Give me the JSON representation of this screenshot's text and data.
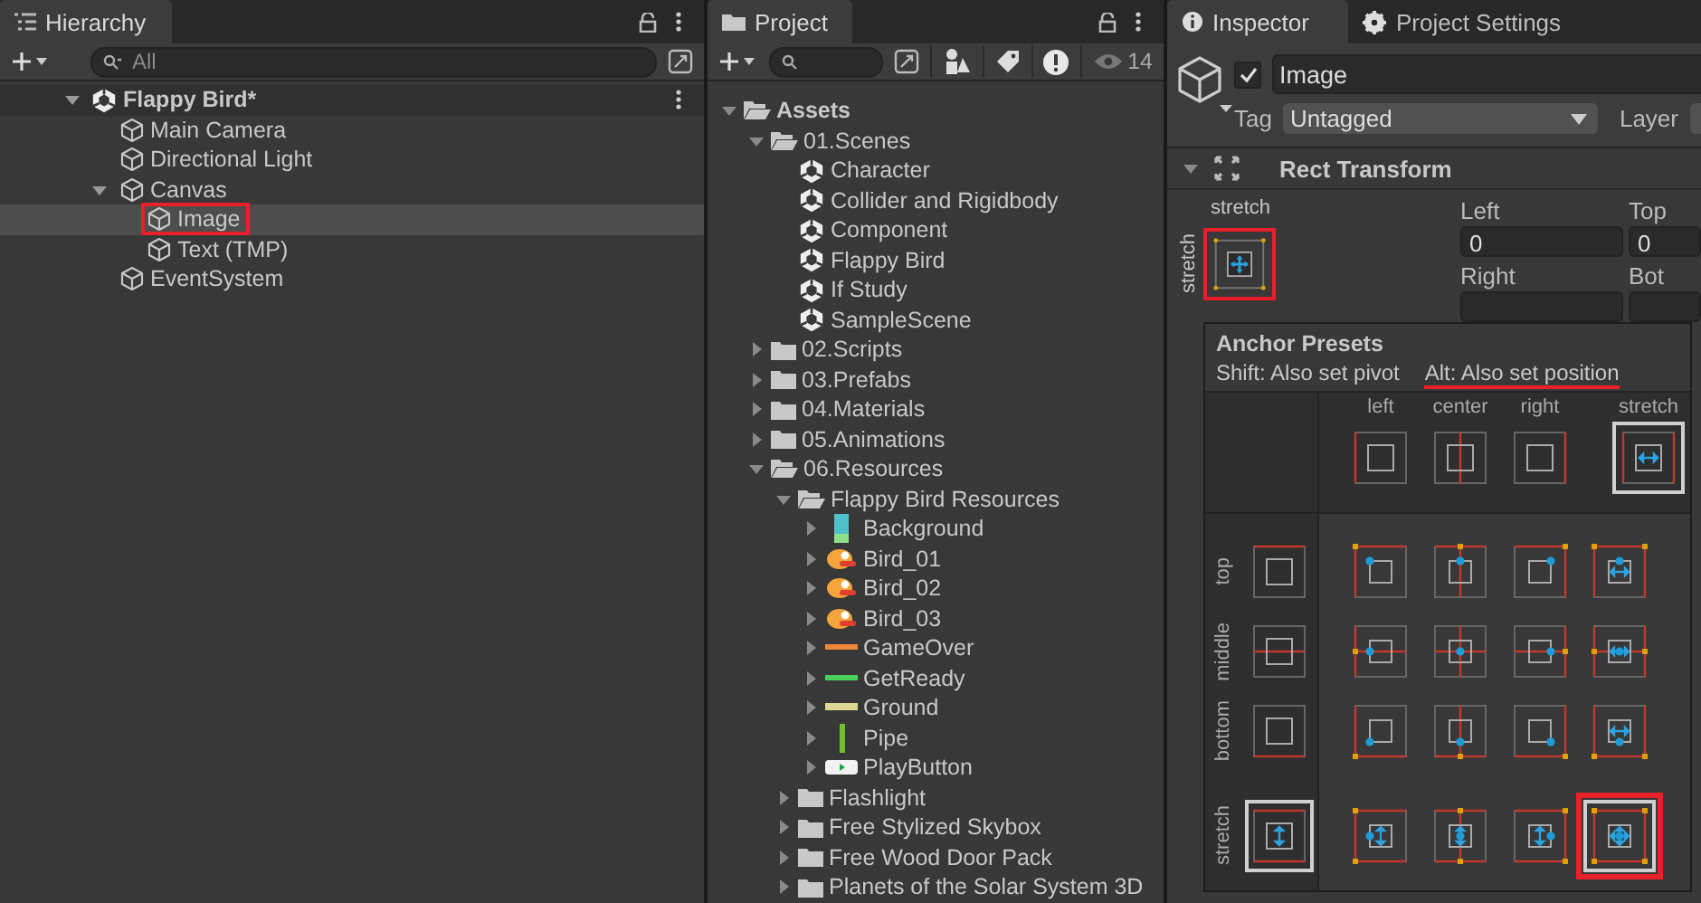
{
  "hierarchy": {
    "tab": "Hierarchy",
    "search": {
      "placeholder": "All"
    },
    "tree": [
      {
        "label": "Flappy Bird*",
        "kind": "scene",
        "expanded": true,
        "selected": false,
        "highlighted": false,
        "children": [
          {
            "label": "Main Camera",
            "kind": "object",
            "selected": false,
            "highlighted": false
          },
          {
            "label": "Directional Light",
            "kind": "object",
            "selected": false,
            "highlighted": false
          },
          {
            "label": "Canvas",
            "kind": "object",
            "expanded": true,
            "selected": false,
            "highlighted": false,
            "children": [
              {
                "label": "Image",
                "kind": "object",
                "selected": true,
                "highlighted": true
              },
              {
                "label": "Text (TMP)",
                "kind": "object",
                "selected": false,
                "highlighted": false
              }
            ]
          },
          {
            "label": "EventSystem",
            "kind": "object",
            "selected": false,
            "highlighted": false
          }
        ]
      }
    ]
  },
  "project": {
    "tab": "Project",
    "hidden_count": "14",
    "tree": [
      {
        "label": "Assets",
        "kind": "folder",
        "expanded": true,
        "children": [
          {
            "label": "01.Scenes",
            "kind": "folder",
            "expanded": true,
            "children": [
              {
                "label": "Character",
                "kind": "scene"
              },
              {
                "label": "Collider and Rigidbody",
                "kind": "scene"
              },
              {
                "label": "Component",
                "kind": "scene"
              },
              {
                "label": "Flappy Bird",
                "kind": "scene"
              },
              {
                "label": "If Study",
                "kind": "scene"
              },
              {
                "label": "SampleScene",
                "kind": "scene"
              }
            ]
          },
          {
            "label": "02.Scripts",
            "kind": "folder",
            "expanded": false
          },
          {
            "label": "03.Prefabs",
            "kind": "folder",
            "expanded": false
          },
          {
            "label": "04.Materials",
            "kind": "folder",
            "expanded": false
          },
          {
            "label": "05.Animations",
            "kind": "folder",
            "expanded": false
          },
          {
            "label": "06.Resources",
            "kind": "folder",
            "expanded": true,
            "children": [
              {
                "label": "Flappy Bird Resources",
                "kind": "folder",
                "expanded": true,
                "children": [
                  {
                    "label": "Background",
                    "kind": "sprite",
                    "expanded": false
                  },
                  {
                    "label": "Bird_01",
                    "kind": "sprite",
                    "expanded": false
                  },
                  {
                    "label": "Bird_02",
                    "kind": "sprite",
                    "expanded": false
                  },
                  {
                    "label": "Bird_03",
                    "kind": "sprite",
                    "expanded": false
                  },
                  {
                    "label": "GameOver",
                    "kind": "sprite",
                    "expanded": false
                  },
                  {
                    "label": "GetReady",
                    "kind": "sprite",
                    "expanded": false
                  },
                  {
                    "label": "Ground",
                    "kind": "sprite",
                    "expanded": false
                  },
                  {
                    "label": "Pipe",
                    "kind": "sprite",
                    "expanded": false
                  },
                  {
                    "label": "PlayButton",
                    "kind": "sprite",
                    "expanded": false
                  }
                ]
              },
              {
                "label": "Flashlight",
                "kind": "folder",
                "expanded": false
              },
              {
                "label": "Free Stylized Skybox",
                "kind": "folder",
                "expanded": false
              },
              {
                "label": "Free Wood Door Pack",
                "kind": "folder",
                "expanded": false
              },
              {
                "label": "Planets of the Solar System 3D",
                "kind": "folder",
                "expanded": false
              }
            ]
          }
        ]
      }
    ]
  },
  "inspector": {
    "tabs": [
      {
        "label": "Inspector",
        "selected": true
      },
      {
        "label": "Project Settings",
        "selected": false
      }
    ],
    "active": true,
    "name": "Image",
    "tag_label": "Tag",
    "tag": "Untagged",
    "layer_label": "Layer",
    "component": {
      "title": "Rect Transform",
      "expanded": true
    },
    "anchor": {
      "h_label": "stretch",
      "v_label": "stretch",
      "highlighted": true
    },
    "fields": [
      {
        "label": "Left",
        "value": "0"
      },
      {
        "label": "Top",
        "value": "0"
      },
      {
        "label": "Right"
      },
      {
        "label": "Bot"
      }
    ]
  },
  "anchor_presets": {
    "title": "Anchor Presets",
    "hints": [
      {
        "text": "Shift: Also set pivot",
        "underlined": false
      },
      {
        "text": "Alt: Also set position",
        "underlined": true
      }
    ],
    "columns": [
      {
        "label": "left",
        "selected": false
      },
      {
        "label": "center",
        "selected": false
      },
      {
        "label": "right",
        "selected": false
      },
      {
        "label": "stretch",
        "selected": true
      }
    ],
    "rows": [
      {
        "label": "top",
        "selected": false,
        "cells": [
          {
            "selected": false,
            "highlighted": false
          },
          {
            "selected": false,
            "highlighted": false
          },
          {
            "selected": false,
            "highlighted": false
          },
          {
            "selected": false,
            "highlighted": false
          }
        ]
      },
      {
        "label": "middle",
        "selected": false,
        "cells": [
          {
            "selected": false,
            "highlighted": false
          },
          {
            "selected": false,
            "highlighted": false
          },
          {
            "selected": false,
            "highlighted": false
          },
          {
            "selected": false,
            "highlighted": false
          }
        ]
      },
      {
        "label": "bottom",
        "selected": false,
        "cells": [
          {
            "selected": false,
            "highlighted": false
          },
          {
            "selected": false,
            "highlighted": false
          },
          {
            "selected": false,
            "highlighted": false
          },
          {
            "selected": false,
            "highlighted": false
          }
        ]
      },
      {
        "label": "stretch",
        "selected": true,
        "cells": [
          {
            "selected": false,
            "highlighted": false
          },
          {
            "selected": false,
            "highlighted": false
          },
          {
            "selected": false,
            "highlighted": false
          },
          {
            "selected": true,
            "highlighted": true
          }
        ]
      }
    ]
  }
}
